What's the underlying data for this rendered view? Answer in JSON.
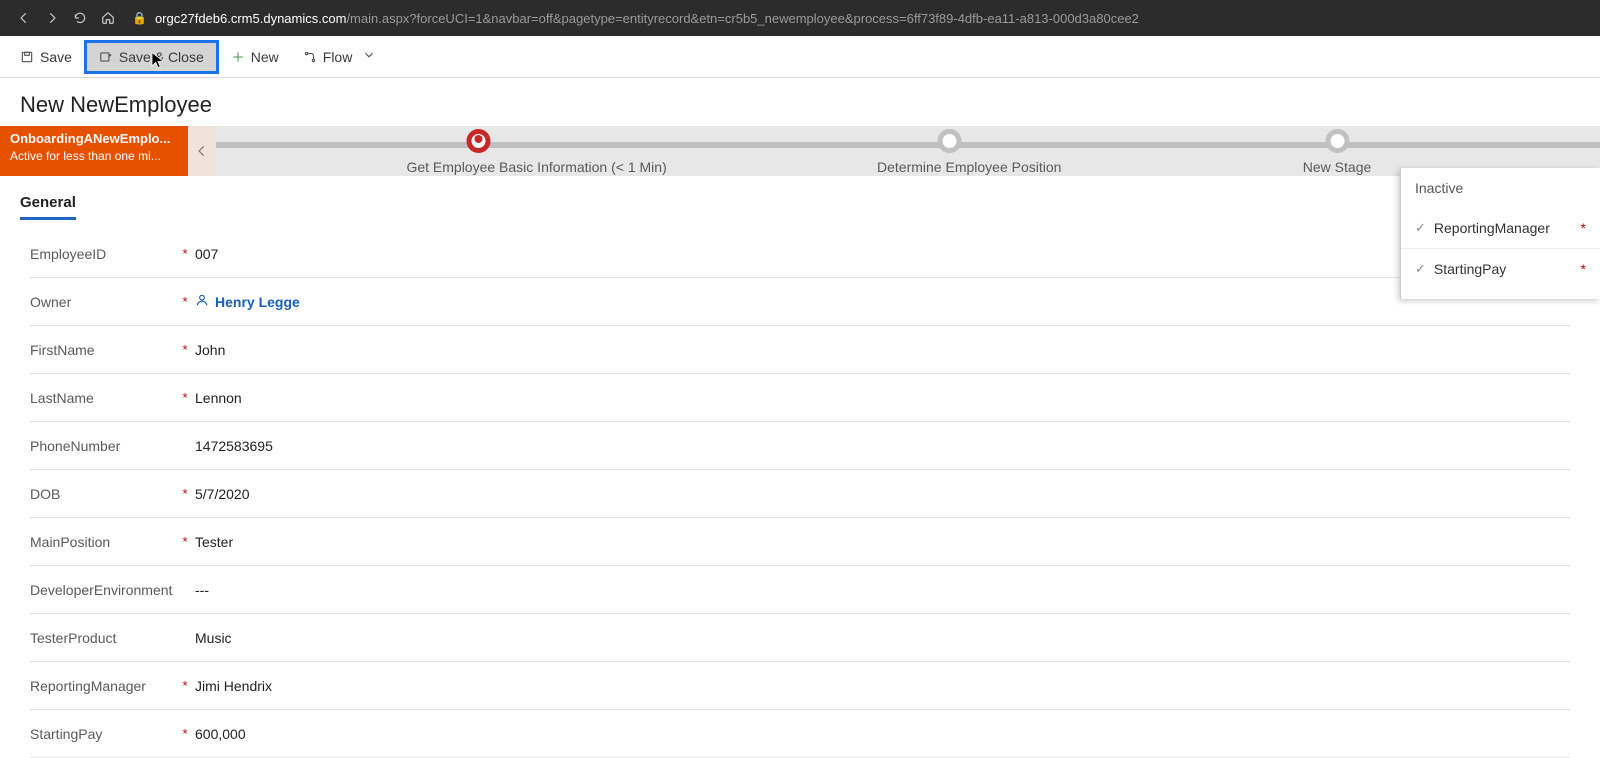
{
  "browser": {
    "host": "orgc27fdeb6.crm5.dynamics.com",
    "path": "/main.aspx?forceUCI=1&navbar=off&pagetype=entityrecord&etn=cr5b5_newemployee&process=6ff73f89-4dfb-ea11-a813-000d3a80cee2"
  },
  "cmd": {
    "save": "Save",
    "saveClose": "Save & Close",
    "new": "New",
    "flow": "Flow"
  },
  "page": {
    "title": "New NewEmployee"
  },
  "bpf": {
    "name": "OnboardingANewEmplo...",
    "status": "Active for less than one mi...",
    "s1": "Get Employee Basic Information  (< 1 Min)",
    "s2": "Determine Employee Position",
    "s3": "New Stage"
  },
  "tab": {
    "general": "General"
  },
  "fields": {
    "employeeId": {
      "label": "EmployeeID",
      "value": "007"
    },
    "owner": {
      "label": "Owner",
      "value": "Henry Legge"
    },
    "firstName": {
      "label": "FirstName",
      "value": "John"
    },
    "lastName": {
      "label": "LastName",
      "value": "Lennon"
    },
    "phone": {
      "label": "PhoneNumber",
      "value": "1472583695"
    },
    "dob": {
      "label": "DOB",
      "value": "5/7/2020"
    },
    "mainPos": {
      "label": "MainPosition",
      "value": "Tester"
    },
    "devEnv": {
      "label": "DeveloperEnvironment",
      "value": "---"
    },
    "testerProd": {
      "label": "TesterProduct",
      "value": "Music"
    },
    "repMgr": {
      "label": "ReportingManager",
      "value": "Jimi Hendrix"
    },
    "startPay": {
      "label": "StartingPay",
      "value": "600,000"
    }
  },
  "flyout": {
    "header": "Inactive",
    "item1": "ReportingManager",
    "item2": "StartingPay"
  }
}
